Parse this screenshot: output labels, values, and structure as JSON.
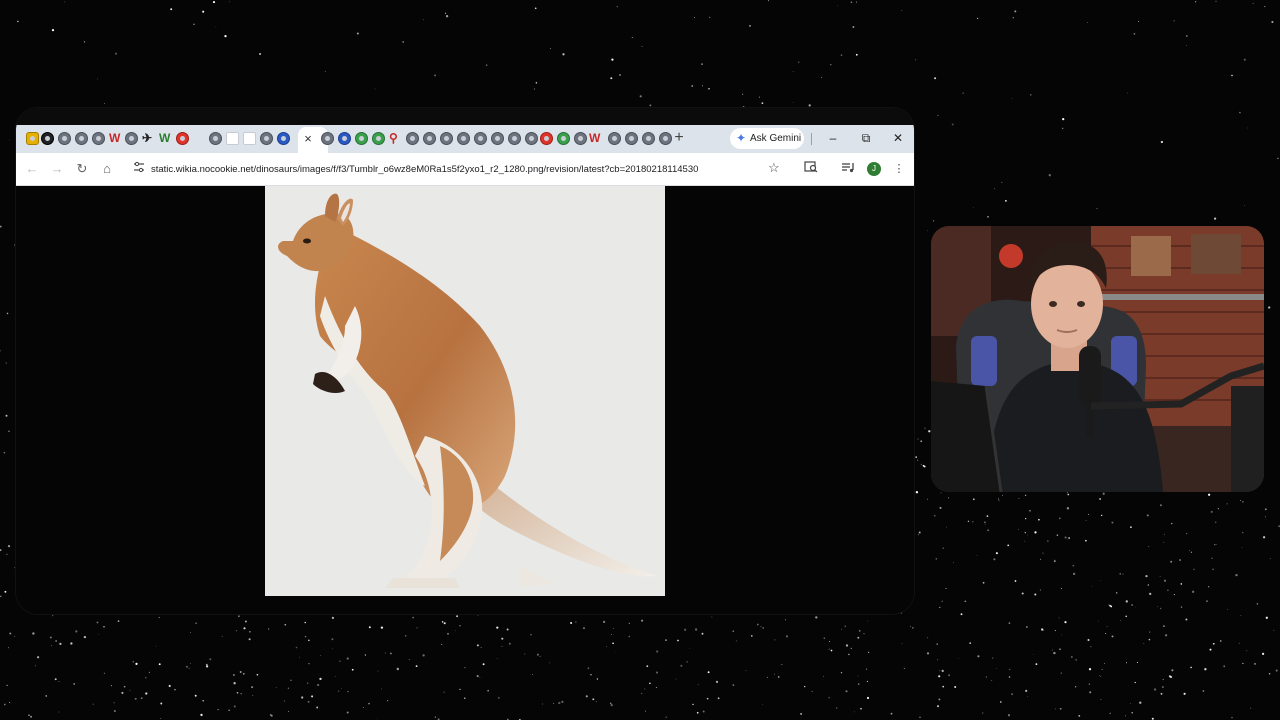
{
  "browser": {
    "tabs": {
      "active_close_glyph": "×",
      "new_tab_glyph": "+",
      "ask_gemini_label": "Ask Gemini"
    },
    "window_controls": {
      "minimize": "–",
      "maximize": "⧉",
      "close": "✕"
    },
    "toolbar": {
      "back_glyph": "←",
      "forward_glyph": "→",
      "reload_glyph": "↻",
      "home_glyph": "⌂",
      "url": "static.wikia.nocookie.net/dinosaurs/images/f/f3/Tumblr_o6wz8eM0Ra1s5f2yxo1_r2_1280.png/revision/latest?cb=20180218114530",
      "bookmark_glyph": "☆",
      "profile_initial": "J",
      "menu_glyph": "⋮"
    }
  },
  "icons": {
    "site_info": "tune-icon",
    "search_image": "search-image-icon",
    "media": "media-control-icon"
  }
}
